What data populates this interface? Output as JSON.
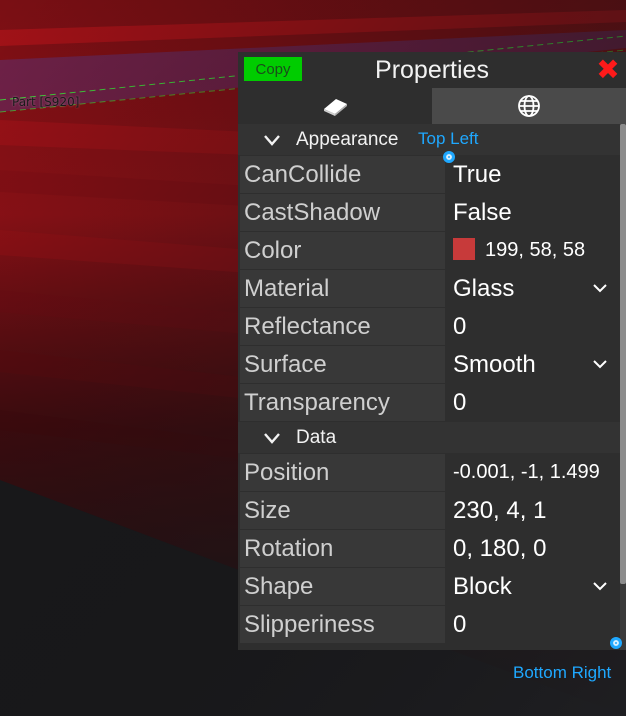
{
  "scene": {
    "part_label": "Part [S920]"
  },
  "panel": {
    "copy_label": "Copy",
    "title": "Properties",
    "close_glyph": "✖",
    "tabs": [
      {
        "name": "part-tab",
        "icon": "part-eraser-icon"
      },
      {
        "name": "world-tab",
        "icon": "globe-icon"
      }
    ]
  },
  "sections": {
    "appearance": "Appearance",
    "data": "Data"
  },
  "properties": {
    "appearance": [
      {
        "name": "CanCollide",
        "value": "True"
      },
      {
        "name": "CastShadow",
        "value": "False"
      },
      {
        "name": "Color",
        "value": "199, 58, 58",
        "swatch": "#c73a3a"
      },
      {
        "name": "Material",
        "value": "Glass",
        "dropdown": true
      },
      {
        "name": "Reflectance",
        "value": "0"
      },
      {
        "name": "Surface",
        "value": "Smooth",
        "dropdown": true
      },
      {
        "name": "Transparency",
        "value": "0"
      }
    ],
    "data": [
      {
        "name": "Position",
        "value": "-0.001, -1, 1.499"
      },
      {
        "name": "Size",
        "value": "230, 4, 1"
      },
      {
        "name": "Rotation",
        "value": "0, 180, 0"
      },
      {
        "name": "Shape",
        "value": "Block",
        "dropdown": true
      },
      {
        "name": "Slipperiness",
        "value": "0"
      }
    ]
  },
  "resize": {
    "top_left_label": "Top Left",
    "bottom_right_label": "Bottom Right"
  },
  "colors": {
    "accent": "#1fa8ff",
    "copy_green": "#00cc00",
    "close_red": "#ff1a1a"
  }
}
